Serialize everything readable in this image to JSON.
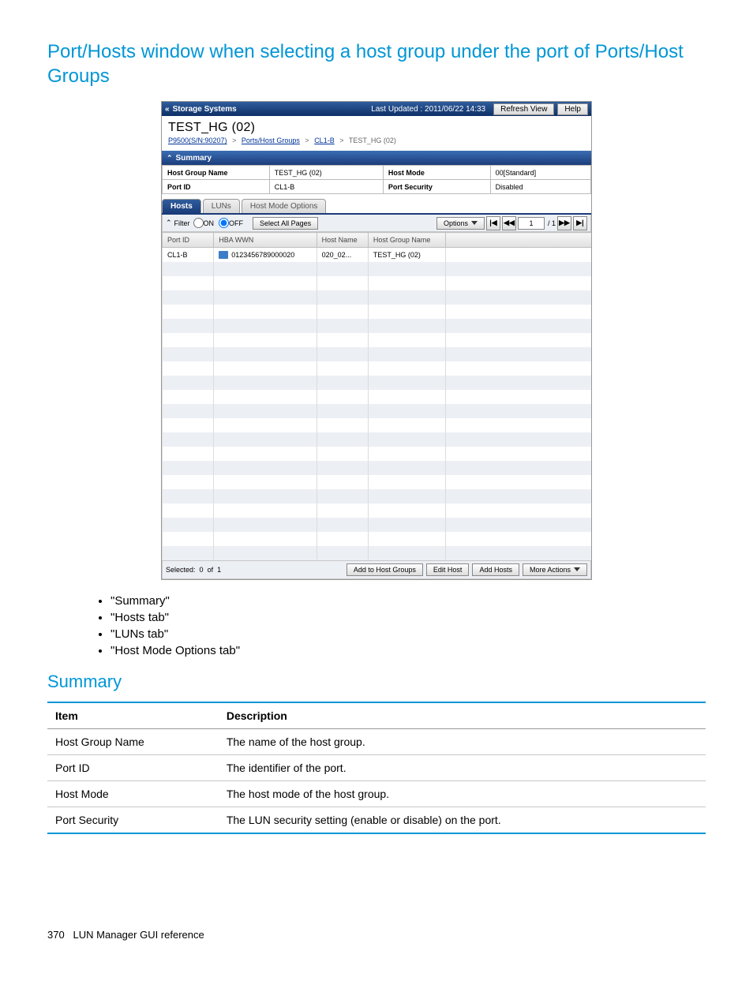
{
  "section_title": "Port/Hosts window when selecting a host group under the port of Ports/Host Groups",
  "shot": {
    "topbar": {
      "title": "Storage Systems",
      "updated": "Last Updated : 2011/06/22 14:33",
      "refresh": "Refresh View",
      "help": "Help"
    },
    "header_name": "TEST_HG (02)",
    "breadcrumb": {
      "p1": "P9500(S/N:90207)",
      "p2": "Ports/Host Groups",
      "p3": "CL1-B",
      "current": "TEST_HG (02)",
      "sep": ">"
    },
    "summary": {
      "label": "Summary",
      "rows": [
        {
          "k1": "Host Group Name",
          "v1": "TEST_HG (02)",
          "k2": "Host Mode",
          "v2": "00[Standard]"
        },
        {
          "k1": "Port ID",
          "v1": "CL1-B",
          "k2": "Port Security",
          "v2": "Disabled"
        }
      ]
    },
    "tabs": {
      "hosts": "Hosts",
      "luns": "LUNs",
      "hmo": "Host Mode Options"
    },
    "filter": {
      "label": "Filter",
      "on": "ON",
      "off": "OFF",
      "select_all": "Select All Pages",
      "options": "Options",
      "page": "1",
      "total": "/ 1"
    },
    "grid": {
      "cols": [
        "Port ID",
        "HBA WWN",
        "Host Name",
        "Host Group Name"
      ],
      "row": {
        "port": "CL1-B",
        "wwn": "0123456789000020",
        "hn": "020_02...",
        "hg": "TEST_HG (02)"
      }
    },
    "footer": {
      "selected_label": "Selected:",
      "selected_count": "0",
      "of": "of",
      "total": "1",
      "b1": "Add to Host Groups",
      "b2": "Edit Host",
      "b3": "Add Hosts",
      "b4": "More Actions"
    }
  },
  "links": [
    "\"Summary\"",
    "\"Hosts tab\"",
    "\"LUNs tab\"",
    "\"Host Mode Options tab\""
  ],
  "sub_title": "Summary",
  "desc_table": {
    "h1": "Item",
    "h2": "Description",
    "rows": [
      {
        "i": "Host Group Name",
        "d": "The name of the host group."
      },
      {
        "i": "Port ID",
        "d": "The identifier of the port."
      },
      {
        "i": "Host Mode",
        "d": "The host mode of the host group."
      },
      {
        "i": "Port Security",
        "d": "The LUN security setting (enable or disable) on the port."
      }
    ]
  },
  "footerline": {
    "page": "370",
    "text": "LUN Manager GUI reference"
  }
}
